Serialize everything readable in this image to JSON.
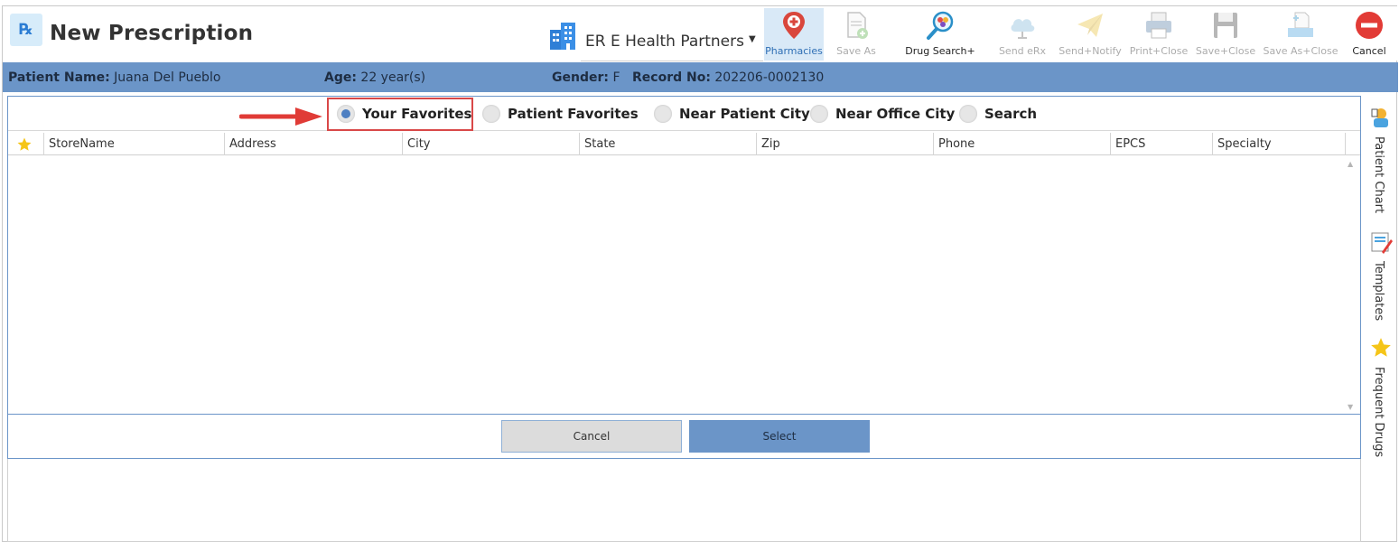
{
  "window": {
    "title": "New Prescription",
    "app_icon": "rx-icon"
  },
  "location": {
    "name": "ER E Health Partners",
    "icon": "building-icon"
  },
  "toolbar": {
    "pharmacies": "Pharmacies",
    "save_as": "Save As",
    "drug_search": "Drug Search+",
    "send_erx": "Send eRx",
    "send_notify": "Send+Notify",
    "print_close": "Print+Close",
    "save_close": "Save+Close",
    "save_as_close": "Save As+Close",
    "cancel": "Cancel"
  },
  "patient": {
    "name_label": "Patient Name:",
    "name": "Juana Del Pueblo",
    "age_label": "Age:",
    "age": "22 year(s)",
    "gender_label": "Gender:",
    "gender": "F",
    "record_label": "Record No:",
    "record": "202206-0002130"
  },
  "filters": {
    "selected": "Your Favorites",
    "options": [
      "Your Favorites",
      "Patient Favorites",
      "Near Patient City",
      "Near Office City",
      "Search"
    ]
  },
  "grid": {
    "columns": [
      "StoreName",
      "Address",
      "City",
      "State",
      "Zip",
      "Phone",
      "EPCS",
      "Specialty"
    ],
    "rows": []
  },
  "actions": {
    "cancel": "Cancel",
    "select": "Select"
  },
  "side_panel": {
    "patient_chart": "Patient Chart",
    "templates": "Templates",
    "frequent_drugs": "Frequent Drugs"
  },
  "colors": {
    "accent": "#6b95c8",
    "highlight": "#d94848",
    "active_tab_bg": "#d9e9f7"
  }
}
